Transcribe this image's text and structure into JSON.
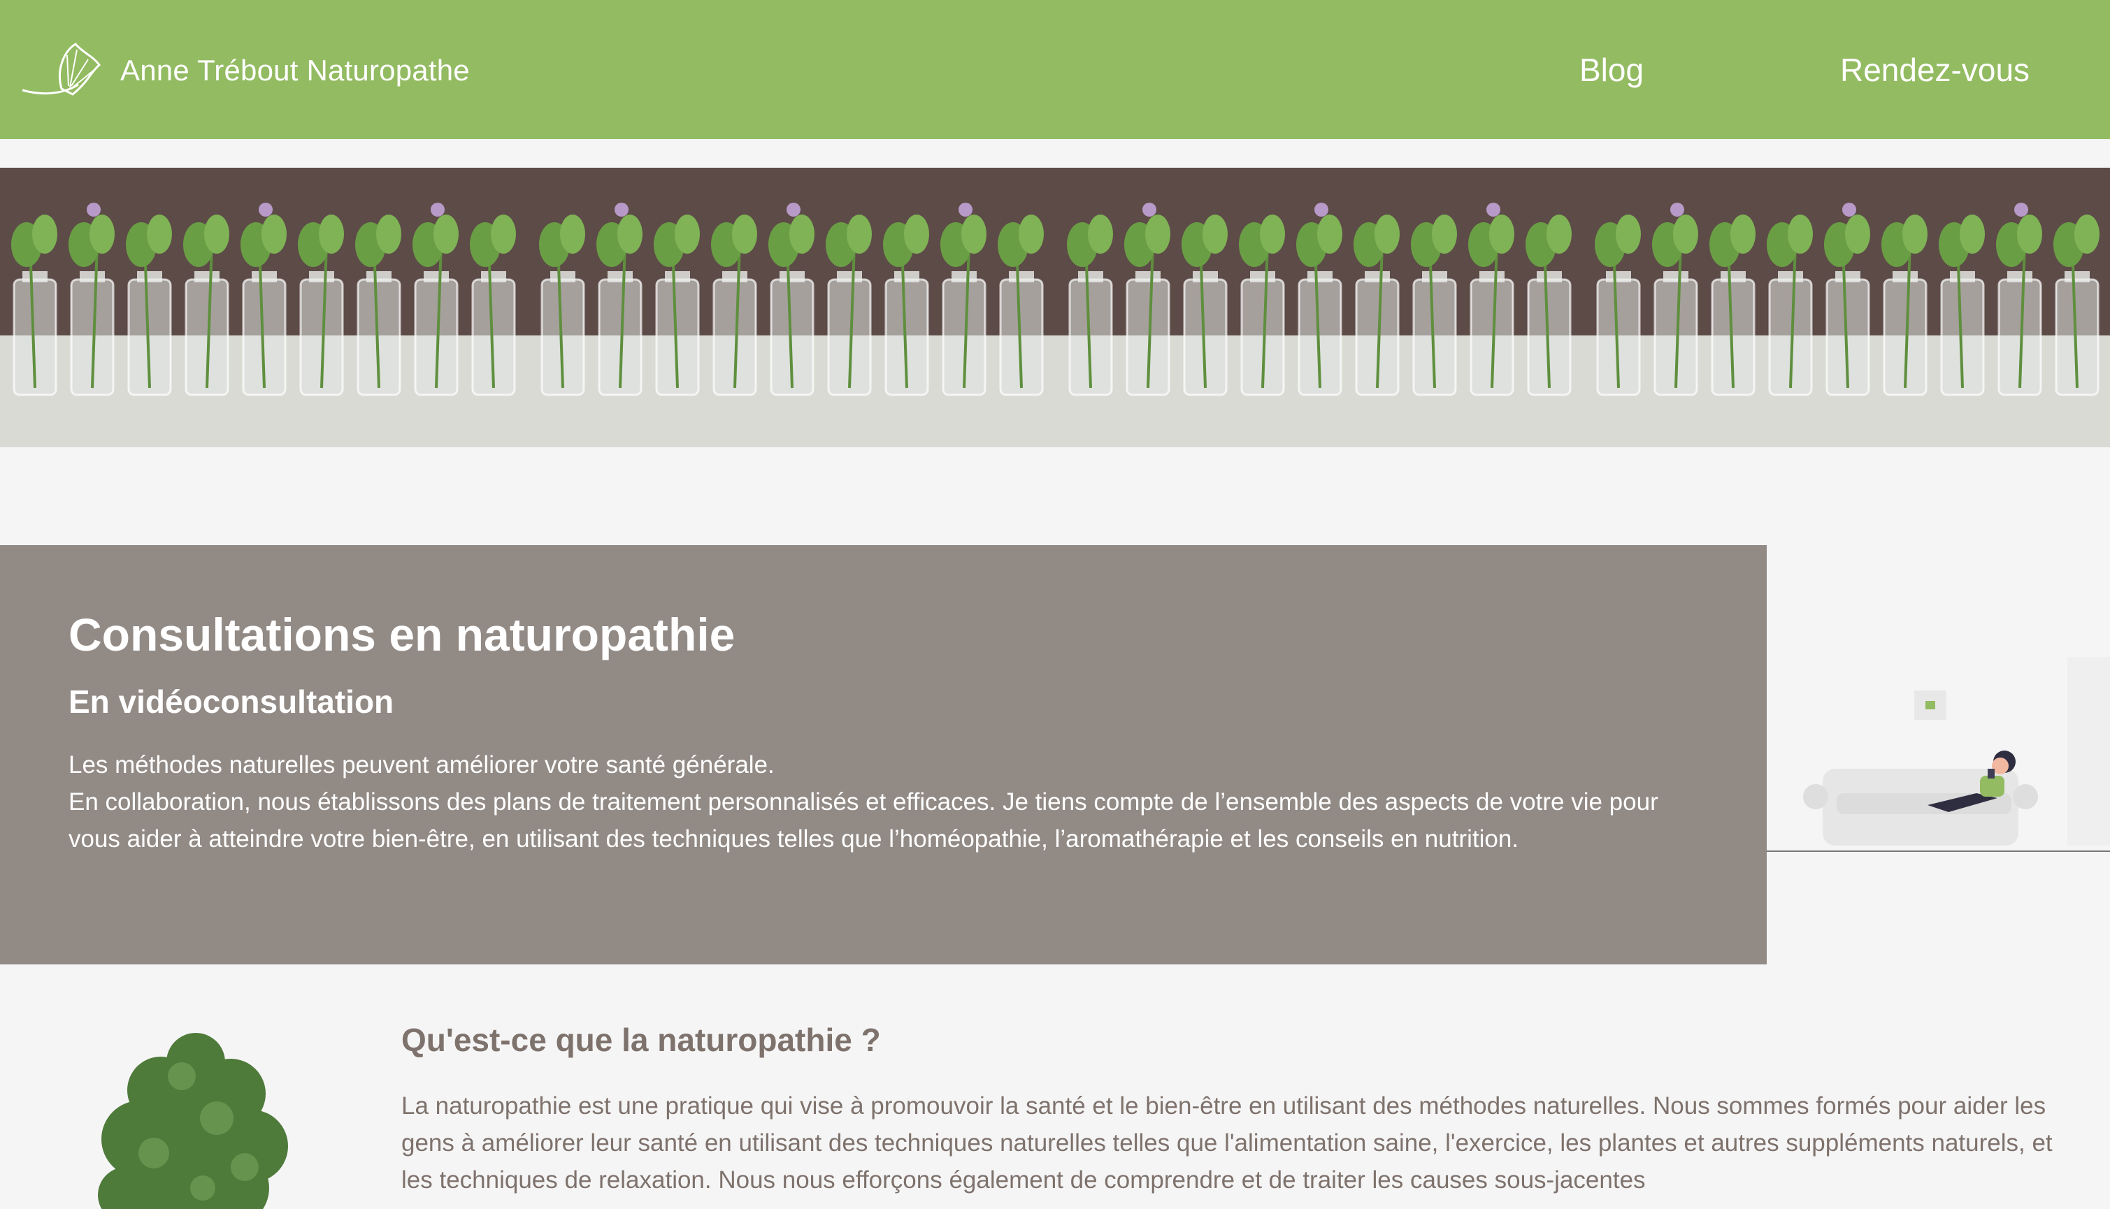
{
  "header": {
    "site_name": "Anne Trébout Naturopathe",
    "nav": [
      {
        "label": "Blog"
      },
      {
        "label": "Rendez-vous"
      }
    ],
    "logo_icon": "ginkgo-leaf-icon"
  },
  "consultation": {
    "title": "Consultations en naturopathie",
    "subtitle": "En vidéoconsultation",
    "line1": "Les méthodes naturelles peuvent améliorer votre santé générale.",
    "line2": "En collaboration, nous établissons des plans de traitement personnalisés et efficaces. Je tiens compte de l’ensemble des aspects de votre vie pour vous aider à atteindre votre bien-être, en utilisant des techniques telles que l’homéopathie, l’aromathérapie et les conseils en nutrition."
  },
  "naturopathy": {
    "title": "Qu'est-ce que la naturopathie ?",
    "text": "La naturopathie est une pratique qui vise à promouvoir la santé et le bien-être en utilisant des méthodes naturelles. Nous sommes formés pour aider les gens à améliorer leur santé en utilisant des techniques naturelles telles que l'alimentation saine, l'exercice, les plantes et autres suppléments naturels, et les techniques de relaxation. Nous nous efforçons également de comprendre et de traiter les causes sous-jacentes"
  },
  "colors": {
    "header_bg": "#93bb62",
    "consult_bg": "#928a85",
    "text_brown": "#7e726c",
    "page_bg": "#f6f5f6"
  }
}
